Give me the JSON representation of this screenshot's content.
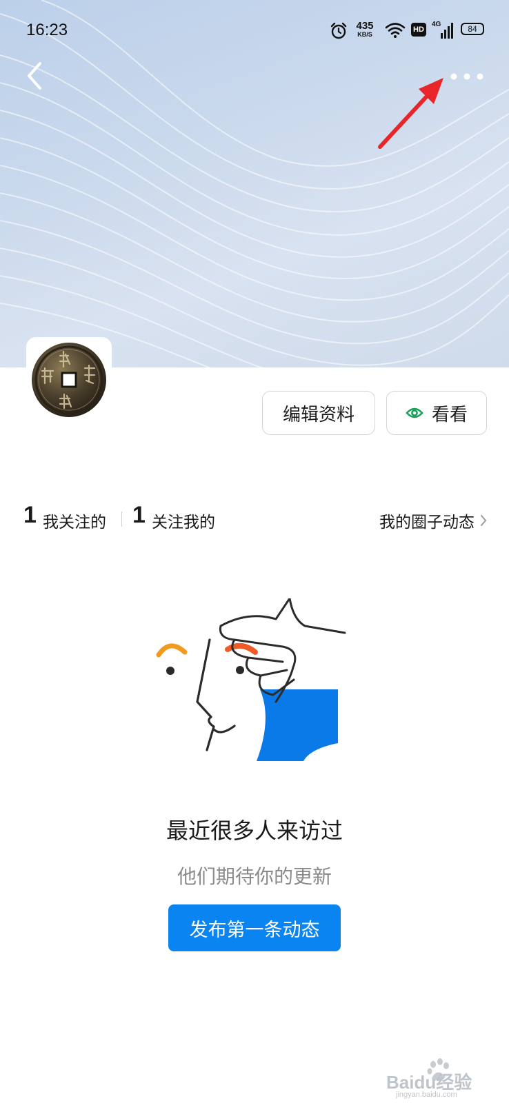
{
  "status_bar": {
    "time": "16:23",
    "net_speed": "435",
    "net_unit": "KB/S",
    "hd_badge": "HD",
    "network_type": "4G",
    "battery": "84",
    "icons": [
      "alarm-icon",
      "wifi-icon",
      "hd-icon",
      "signal-icon",
      "battery-icon"
    ]
  },
  "header": {
    "back_icon": "chevron-left-icon",
    "more_icon": "more-dots-icon"
  },
  "profile": {
    "edit_button": "编辑资料",
    "look_button": "看看",
    "look_icon": "eye-icon"
  },
  "stats": {
    "following_count": "1",
    "following_label": "我关注的",
    "followers_count": "1",
    "followers_label": "关注我的",
    "circle_link": "我的圈子动态"
  },
  "empty_state": {
    "title": "最近很多人来访过",
    "subtitle": "他们期待你的更新",
    "button": "发布第一条动态"
  },
  "watermark": {
    "text": "Baidu经验",
    "url": "jingyan.baidu.com"
  },
  "colors": {
    "primary": "#0a84f0",
    "annotation_arrow": "#e8262a",
    "eye_icon": "#1aa058",
    "illustration_orange": "#f29a1f",
    "illustration_red": "#f05a28",
    "illustration_blue": "#0a7ae8"
  }
}
